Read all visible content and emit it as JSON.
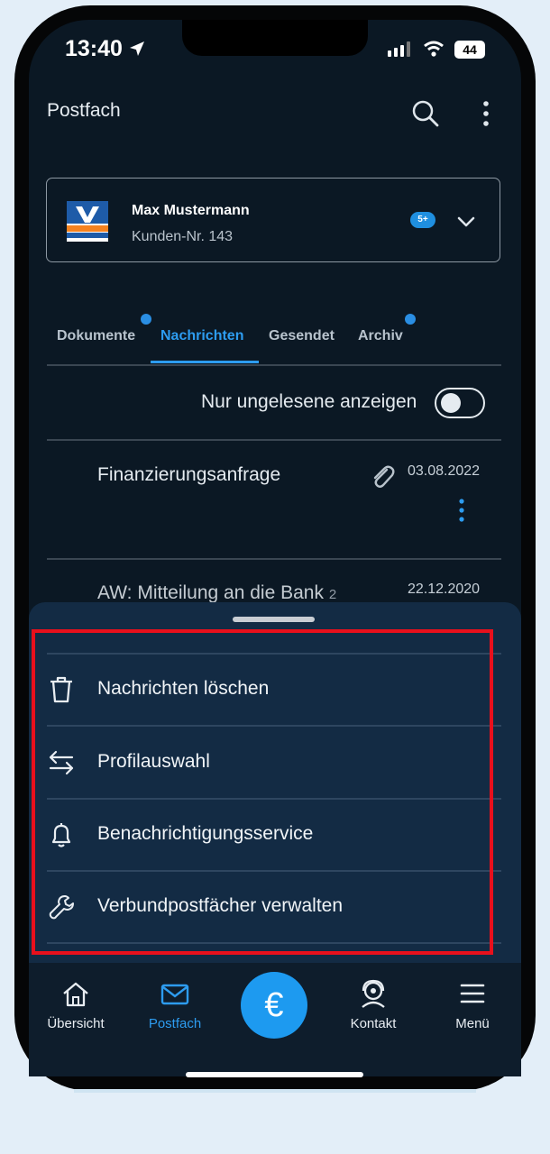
{
  "status_bar": {
    "time": "13:40",
    "battery": "44"
  },
  "header": {
    "title": "Postfach"
  },
  "account": {
    "name": "Max Mustermann",
    "customer_number": "Kunden-Nr. 143",
    "badge": "5+"
  },
  "tabs": [
    {
      "label": "Dokumente",
      "active": false,
      "unread_dot": true
    },
    {
      "label": "Nachrichten",
      "active": true,
      "unread_dot": false
    },
    {
      "label": "Gesendet",
      "active": false,
      "unread_dot": false
    },
    {
      "label": "Archiv",
      "active": false,
      "unread_dot": true
    }
  ],
  "filter": {
    "label": "Nur ungelesene anzeigen",
    "enabled": false
  },
  "messages": [
    {
      "subject": "Finanzierungsanfrage",
      "date": "03.08.2022",
      "has_attachment": true
    },
    {
      "subject": "AW: Mitteilung an die Bank",
      "count": "2",
      "date": "22.12.2020"
    }
  ],
  "action_sheet": {
    "items": [
      {
        "label": "Nachrichten löschen",
        "icon": "trash-icon"
      },
      {
        "label": "Profilauswahl",
        "icon": "swap-arrows-icon"
      },
      {
        "label": "Benachrichtigungsservice",
        "icon": "bell-icon"
      },
      {
        "label": "Verbundpostfächer verwalten",
        "icon": "wrench-icon"
      }
    ]
  },
  "bottom_nav": {
    "items": [
      {
        "label": "Übersicht",
        "icon": "home-icon",
        "active": false
      },
      {
        "label": "Postfach",
        "icon": "mail-icon",
        "active": true
      },
      {
        "label": "",
        "icon": "euro-icon",
        "active": false
      },
      {
        "label": "Kontakt",
        "icon": "contact-icon",
        "active": false
      },
      {
        "label": "Menü",
        "icon": "hamburger-icon",
        "active": false
      }
    ],
    "center_symbol": "€"
  },
  "colors": {
    "accent": "#2d9cf0",
    "background": "#0b1824",
    "sheet": "#132b44",
    "highlight": "#e8101c"
  }
}
